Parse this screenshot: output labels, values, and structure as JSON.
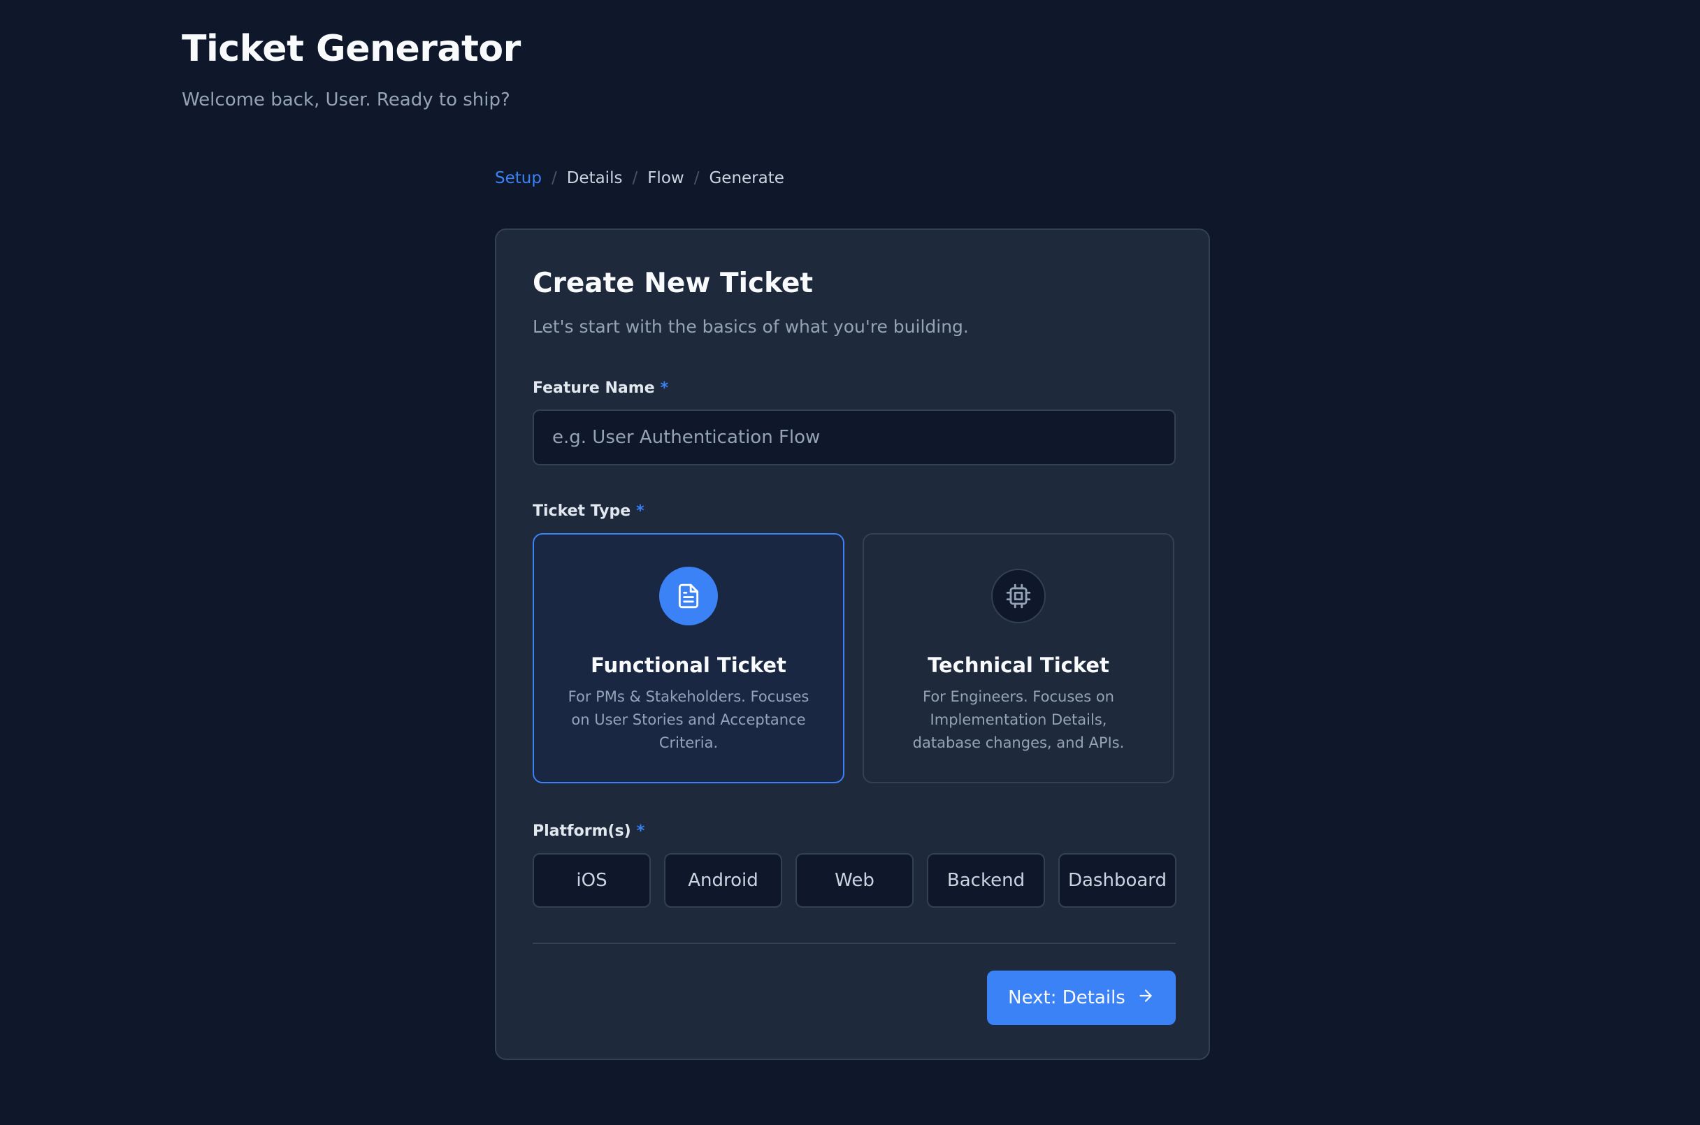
{
  "header": {
    "title": "Ticket Generator",
    "subtitle": "Welcome back, User. Ready to ship?"
  },
  "breadcrumb": [
    {
      "label": "Setup",
      "active": true
    },
    {
      "label": "Details",
      "active": false
    },
    {
      "label": "Flow",
      "active": false
    },
    {
      "label": "Generate",
      "active": false
    }
  ],
  "breadcrumb_separator": "/",
  "card": {
    "title": "Create New Ticket",
    "description": "Let's start with the basics of what you're building."
  },
  "feature_name": {
    "label": "Feature Name",
    "required_marker": "*",
    "value": "",
    "placeholder": "e.g. User Authentication Flow"
  },
  "ticket_type": {
    "label": "Ticket Type",
    "required_marker": "*",
    "options": [
      {
        "title": "Functional Ticket",
        "description": "For PMs & Stakeholders. Focuses on User Stories and Acceptance Criteria.",
        "icon": "document-icon",
        "selected": true
      },
      {
        "title": "Technical Ticket",
        "description": "For Engineers. Focuses on Implementation Details, database changes, and APIs.",
        "icon": "cpu-chip-icon",
        "selected": false
      }
    ]
  },
  "platforms": {
    "label": "Platform(s)",
    "required_marker": "*",
    "options": [
      "iOS",
      "Android",
      "Web",
      "Backend",
      "Dashboard"
    ]
  },
  "actions": {
    "next_label": "Next: Details",
    "next_icon": "arrow-right-icon"
  },
  "colors": {
    "background": "#0f172a",
    "card": "#1e293b",
    "accent": "#3b82f6",
    "border": "#334155",
    "muted_text": "#94a3b8"
  }
}
